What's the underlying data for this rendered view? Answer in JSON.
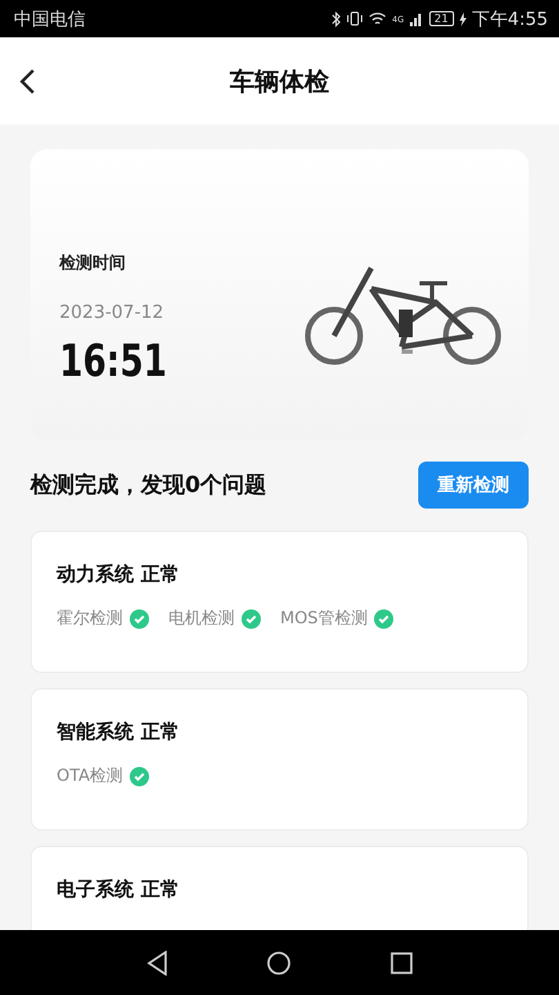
{
  "status_bar": {
    "carrier": "中国电信",
    "network": "4G",
    "battery": "21",
    "time": "下午4:55"
  },
  "header": {
    "title": "车辆体检"
  },
  "inspection": {
    "label": "检测时间",
    "date": "2023-07-12",
    "time": "16:51"
  },
  "summary": {
    "text": "检测完成，发现0个问题",
    "button": "重新检测"
  },
  "systems": [
    {
      "title": "动力系统 正常",
      "checks": [
        {
          "name": "霍尔检测",
          "passed": true
        },
        {
          "name": "电机检测",
          "passed": true
        },
        {
          "name": "MOS管检测",
          "passed": true
        }
      ]
    },
    {
      "title": "智能系统 正常",
      "checks": [
        {
          "name": "OTA检测",
          "passed": true
        }
      ]
    },
    {
      "title": "电子系统 正常"
    }
  ]
}
